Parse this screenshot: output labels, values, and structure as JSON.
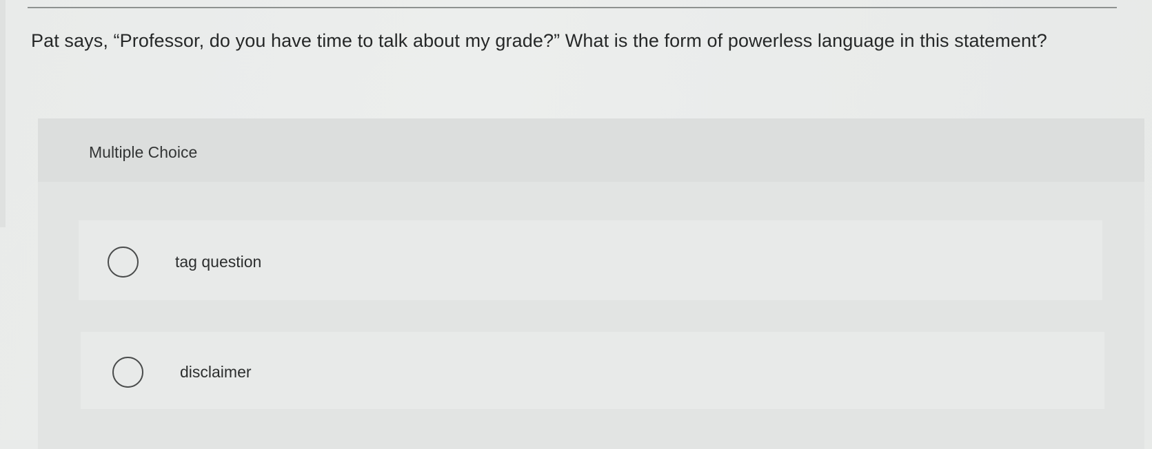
{
  "question": {
    "text": "Pat says, “Professor, do you have time to talk about my grade?” What is the form of powerless language in this statement?"
  },
  "card": {
    "label": "Multiple Choice"
  },
  "options": [
    {
      "label": "tag question",
      "selected": false
    },
    {
      "label": "disclaimer",
      "selected": false
    }
  ]
}
